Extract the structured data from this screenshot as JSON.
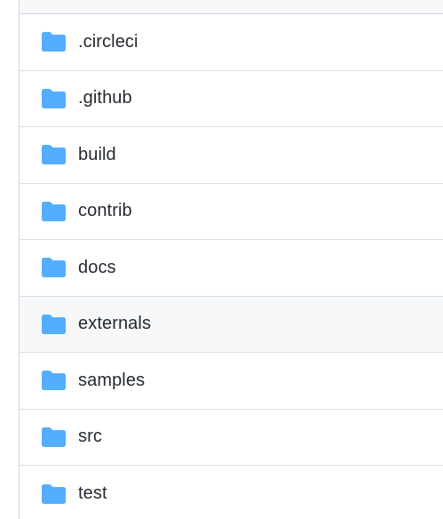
{
  "file_list": {
    "icon": "folder-icon",
    "icon_color": "#54aeff",
    "hover_row_color": "#f6f8fa",
    "items": [
      {
        "name": ".circleci",
        "type": "folder"
      },
      {
        "name": ".github",
        "type": "folder"
      },
      {
        "name": "build",
        "type": "folder"
      },
      {
        "name": "contrib",
        "type": "folder"
      },
      {
        "name": "docs",
        "type": "folder"
      },
      {
        "name": "externals",
        "type": "folder",
        "hovered": true
      },
      {
        "name": "samples",
        "type": "folder"
      },
      {
        "name": "src",
        "type": "folder"
      },
      {
        "name": "test",
        "type": "folder"
      }
    ]
  }
}
